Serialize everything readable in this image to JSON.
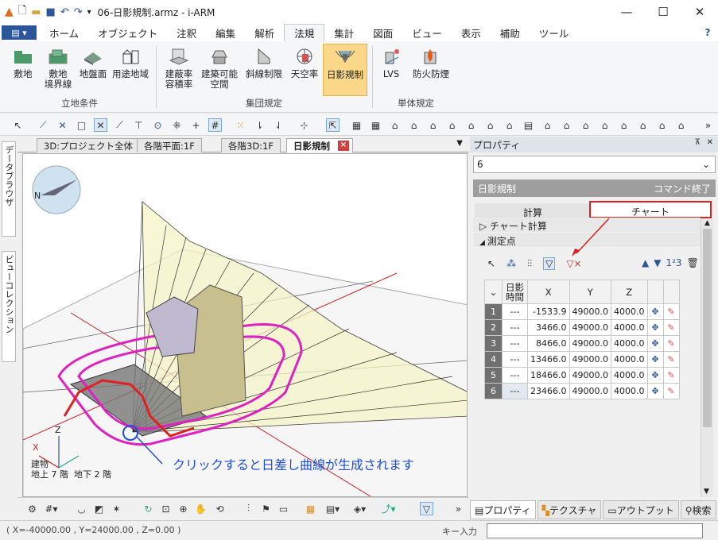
{
  "window": {
    "title": "06-日影規制.armz - i-ARM",
    "minimize": "—",
    "maximize": "☐",
    "close": "✕"
  },
  "menu": {
    "file_icon": "file-menu-icon",
    "tabs": [
      "ホーム",
      "オブジェクト",
      "注釈",
      "編集",
      "解析",
      "法規",
      "集計",
      "図面",
      "ビュー",
      "表示",
      "補助",
      "ツール"
    ],
    "active": "法規",
    "help": "?"
  },
  "ribbon": {
    "buttons": [
      {
        "label": "敷地",
        "icon": "site-icon"
      },
      {
        "label": "敷地\n境界線",
        "icon": "site-boundary-icon"
      },
      {
        "label": "地盤面",
        "icon": "ground-surface-icon"
      },
      {
        "label": "用途地域",
        "icon": "zoning-icon"
      },
      {
        "label": "建蔽率\n容積率",
        "icon": "coverage-ratio-icon"
      },
      {
        "label": "建築可能\n空間",
        "icon": "buildable-space-icon"
      },
      {
        "label": "斜線制限",
        "icon": "slant-restriction-icon"
      },
      {
        "label": "天空率",
        "icon": "sky-factor-icon"
      },
      {
        "label": "日影規制",
        "icon": "shadow-regulation-icon"
      },
      {
        "label": "LVS",
        "icon": "lvs-icon"
      },
      {
        "label": "防火防煙",
        "icon": "fire-smoke-icon"
      }
    ],
    "groups": [
      "立地条件",
      "集団規定",
      "単体規定"
    ]
  },
  "doc_tabs": [
    {
      "label": "3D:プロジェクト全体"
    },
    {
      "label": "各階平面:1F"
    },
    {
      "label": "各階3D:1F"
    },
    {
      "label": "日影規制",
      "close": "×"
    }
  ],
  "left_tabs": [
    "データブラウザ",
    "ビューコレクション"
  ],
  "viewport": {
    "compass_n": "N",
    "axis_z": "Z",
    "axis_x": "X",
    "info_line1": "建物",
    "info_line2": "地上 7 階  地下 2 階",
    "callout": "クリックすると日差し曲線が生成されます"
  },
  "panel": {
    "title": "プロパティ",
    "pin": "⊼",
    "close": "✕",
    "select_value": "6",
    "command_title": "日影規制",
    "command_end": "コマンド終了",
    "tab_calc": "計算",
    "tab_chart": "チャート",
    "tree_chart_calc": "チャート計算",
    "tree_points": "測定点",
    "grid_headers": [
      "日影\n時間",
      "X",
      "Y",
      "Z"
    ],
    "rows": [
      {
        "n": "1",
        "time": "---",
        "x": "-1533.9",
        "y": "49000.0",
        "z": "4000.0"
      },
      {
        "n": "2",
        "time": "---",
        "x": "3466.0",
        "y": "49000.0",
        "z": "4000.0"
      },
      {
        "n": "3",
        "time": "---",
        "x": "8466.0",
        "y": "49000.0",
        "z": "4000.0"
      },
      {
        "n": "4",
        "time": "---",
        "x": "13466.0",
        "y": "49000.0",
        "z": "4000.0"
      },
      {
        "n": "5",
        "time": "---",
        "x": "18466.0",
        "y": "49000.0",
        "z": "4000.0"
      },
      {
        "n": "6",
        "time": "---",
        "x": "23466.0",
        "y": "49000.0",
        "z": "4000.0"
      }
    ],
    "bottom_tabs": [
      "プロパティ",
      "テクスチャ",
      "アウトプット",
      "検索"
    ]
  },
  "status": {
    "coords": "( X=-40000.00 , Y=24000.00 , Z=0.00 )",
    "key_input_label": "キー入力",
    "key_input_value": ""
  },
  "colors": {
    "accent": "#2b579a",
    "highlight": "#e02020",
    "active_button": "#fbd889",
    "callout": "#1e4fd8"
  }
}
